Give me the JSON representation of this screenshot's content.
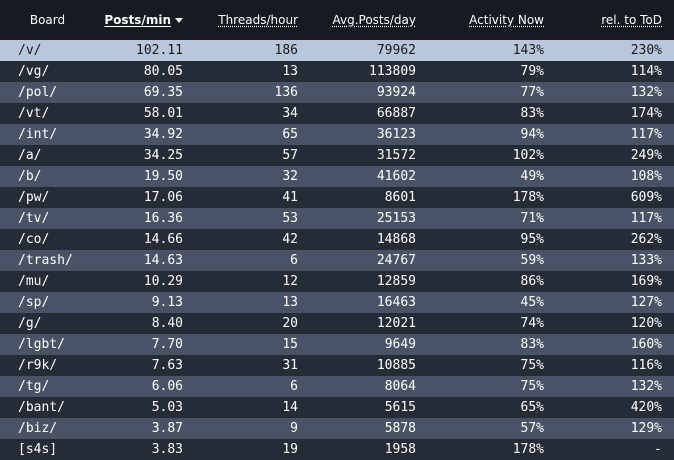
{
  "columns": {
    "board": "Board",
    "posts_min": "Posts/min",
    "threads_hour": "Threads/hour",
    "avg_posts_day": "Avg.Posts/day",
    "activity_now": "Activity Now",
    "rel_tod": "rel. to ToD"
  },
  "sort": {
    "column": "posts_min",
    "direction": "descending"
  },
  "rows": [
    {
      "board": "/v/",
      "posts_min": "102.11",
      "threads_hour": "186",
      "avg_posts_day": "79962",
      "activity_now": "143%",
      "rel_tod": "230%"
    },
    {
      "board": "/vg/",
      "posts_min": "80.05",
      "threads_hour": "13",
      "avg_posts_day": "113809",
      "activity_now": "79%",
      "rel_tod": "114%"
    },
    {
      "board": "/pol/",
      "posts_min": "69.35",
      "threads_hour": "136",
      "avg_posts_day": "93924",
      "activity_now": "77%",
      "rel_tod": "132%"
    },
    {
      "board": "/vt/",
      "posts_min": "58.01",
      "threads_hour": "34",
      "avg_posts_day": "66887",
      "activity_now": "83%",
      "rel_tod": "174%"
    },
    {
      "board": "/int/",
      "posts_min": "34.92",
      "threads_hour": "65",
      "avg_posts_day": "36123",
      "activity_now": "94%",
      "rel_tod": "117%"
    },
    {
      "board": "/a/",
      "posts_min": "34.25",
      "threads_hour": "57",
      "avg_posts_day": "31572",
      "activity_now": "102%",
      "rel_tod": "249%"
    },
    {
      "board": "/b/",
      "posts_min": "19.50",
      "threads_hour": "32",
      "avg_posts_day": "41602",
      "activity_now": "49%",
      "rel_tod": "108%"
    },
    {
      "board": "/pw/",
      "posts_min": "17.06",
      "threads_hour": "41",
      "avg_posts_day": "8601",
      "activity_now": "178%",
      "rel_tod": "609%"
    },
    {
      "board": "/tv/",
      "posts_min": "16.36",
      "threads_hour": "53",
      "avg_posts_day": "25153",
      "activity_now": "71%",
      "rel_tod": "117%"
    },
    {
      "board": "/co/",
      "posts_min": "14.66",
      "threads_hour": "42",
      "avg_posts_day": "14868",
      "activity_now": "95%",
      "rel_tod": "262%"
    },
    {
      "board": "/trash/",
      "posts_min": "14.63",
      "threads_hour": "6",
      "avg_posts_day": "24767",
      "activity_now": "59%",
      "rel_tod": "133%"
    },
    {
      "board": "/mu/",
      "posts_min": "10.29",
      "threads_hour": "12",
      "avg_posts_day": "12859",
      "activity_now": "86%",
      "rel_tod": "169%"
    },
    {
      "board": "/sp/",
      "posts_min": "9.13",
      "threads_hour": "13",
      "avg_posts_day": "16463",
      "activity_now": "45%",
      "rel_tod": "127%"
    },
    {
      "board": "/g/",
      "posts_min": "8.40",
      "threads_hour": "20",
      "avg_posts_day": "12021",
      "activity_now": "74%",
      "rel_tod": "120%"
    },
    {
      "board": "/lgbt/",
      "posts_min": "7.70",
      "threads_hour": "15",
      "avg_posts_day": "9649",
      "activity_now": "83%",
      "rel_tod": "160%"
    },
    {
      "board": "/r9k/",
      "posts_min": "7.63",
      "threads_hour": "31",
      "avg_posts_day": "10885",
      "activity_now": "75%",
      "rel_tod": "116%"
    },
    {
      "board": "/tg/",
      "posts_min": "6.06",
      "threads_hour": "6",
      "avg_posts_day": "8064",
      "activity_now": "75%",
      "rel_tod": "132%"
    },
    {
      "board": "/bant/",
      "posts_min": "5.03",
      "threads_hour": "14",
      "avg_posts_day": "5615",
      "activity_now": "65%",
      "rel_tod": "420%"
    },
    {
      "board": "/biz/",
      "posts_min": "3.87",
      "threads_hour": "9",
      "avg_posts_day": "5878",
      "activity_now": "57%",
      "rel_tod": "129%"
    },
    {
      "board": "[s4s]",
      "posts_min": "3.83",
      "threads_hour": "19",
      "avg_posts_day": "1958",
      "activity_now": "178%",
      "rel_tod": "-"
    }
  ],
  "highlighted_row": 0,
  "colors": {
    "header_bg": "#161a21",
    "row_dark": "#262c36",
    "row_light": "#4a5366",
    "row_highlight": "#b9c7db"
  }
}
